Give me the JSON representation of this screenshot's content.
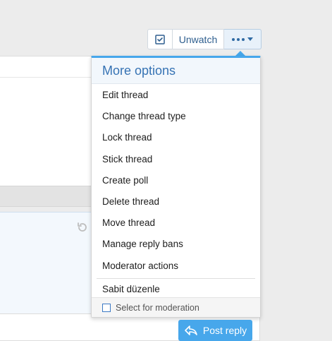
{
  "toolbar": {
    "check_icon": "check-square-icon",
    "unwatch_label": "Unwatch",
    "more_icon": "ellipsis-icon"
  },
  "menu": {
    "header": "More options",
    "items": [
      {
        "label": "Edit thread"
      },
      {
        "label": "Change thread type"
      },
      {
        "label": "Lock thread"
      },
      {
        "label": "Stick thread"
      },
      {
        "label": "Create poll"
      },
      {
        "label": "Delete thread"
      },
      {
        "label": "Move thread"
      },
      {
        "label": "Manage reply bans"
      },
      {
        "label": "Moderator actions"
      }
    ],
    "extra_item": "Sabit düzenle",
    "footer_label": "Select for moderation"
  },
  "post_reply": {
    "label": "Post reply",
    "icon": "reply-icon"
  },
  "colors": {
    "accent": "#47a7eb",
    "link": "#2f5f8f",
    "menu_title": "#3673b4"
  }
}
